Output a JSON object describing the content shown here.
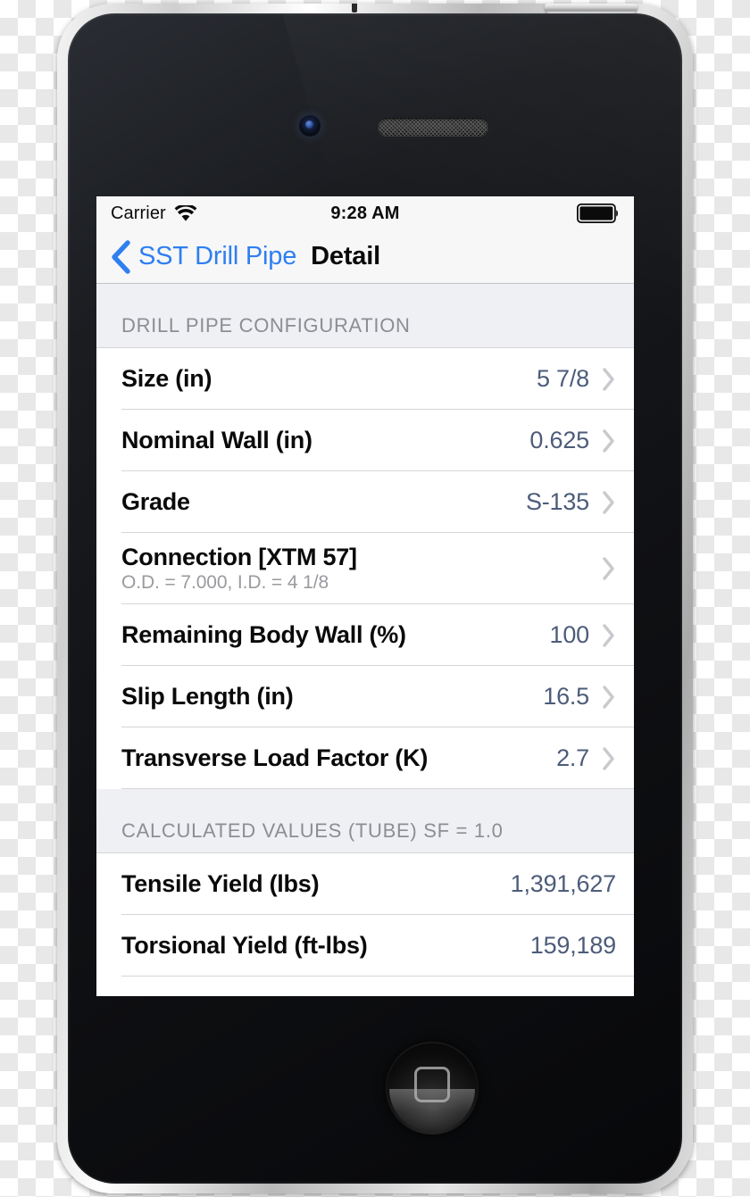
{
  "device": {
    "name": "iphone-4-black",
    "buttons": [
      "mute-switch",
      "volume-up",
      "volume-down",
      "power-button",
      "home-button"
    ]
  },
  "status_bar": {
    "carrier": "Carrier",
    "wifi_icon": "wifi-icon",
    "time": "9:28 AM",
    "battery_icon": "battery-full-icon"
  },
  "nav_bar": {
    "back_icon": "chevron-left-icon",
    "back_label": "SST Drill Pipe",
    "title": "Detail",
    "link_color": "#2f7ff0"
  },
  "colors": {
    "value_text": "#4d5c7a",
    "section_header_bg": "#eef0f4",
    "section_header_text": "#8d8d94",
    "chevron": "#c9c9ce",
    "separator": "#d6d6da"
  },
  "sections": [
    {
      "header": "DRILL PIPE CONFIGURATION",
      "rows": [
        {
          "title": "Size (in)",
          "value": "5 7/8",
          "chevron": true
        },
        {
          "title": "Nominal Wall (in)",
          "value": "0.625",
          "chevron": true
        },
        {
          "title": "Grade",
          "value": "S-135",
          "chevron": true
        },
        {
          "title": "Connection [XTM 57]",
          "subtitle": "O.D. = 7.000, I.D. = 4 1/8",
          "value": "",
          "chevron": true
        },
        {
          "title": "Remaining Body Wall (%)",
          "value": "100",
          "chevron": true
        },
        {
          "title": "Slip Length (in)",
          "value": "16.5",
          "chevron": true
        },
        {
          "title": "Transverse Load Factor (K)",
          "value": "2.7",
          "chevron": true
        }
      ]
    },
    {
      "header": "CALCULATED VALUES (TUBE) SF = 1.0",
      "rows": [
        {
          "title": "Tensile Yield (lbs)",
          "value": "1,391,627",
          "chevron": false
        },
        {
          "title": "Torsional Yield (ft-lbs)",
          "value": "159,189",
          "chevron": false
        }
      ]
    }
  ]
}
